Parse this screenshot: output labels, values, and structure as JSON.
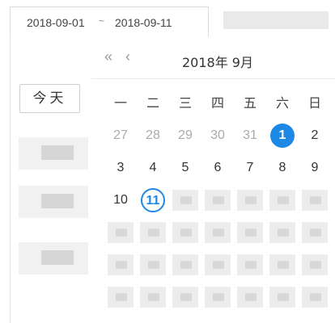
{
  "range": {
    "start": "2018-09-01",
    "separator": "~",
    "end": "2018-09-11"
  },
  "sidebar": {
    "today_label": "今天"
  },
  "calendar": {
    "title": "2018年 9月",
    "nav_prev_year": "«",
    "nav_prev_month": "‹",
    "weekdays": [
      "一",
      "二",
      "三",
      "四",
      "五",
      "六",
      "日"
    ],
    "row1": [
      "27",
      "28",
      "29",
      "30",
      "31",
      "1",
      "2"
    ],
    "row2": [
      "3",
      "4",
      "5",
      "6",
      "7",
      "8",
      "9"
    ],
    "row3_visible": [
      "10",
      "11"
    ],
    "selected_day": "1",
    "today_day": "11"
  },
  "colors": {
    "accent": "#1e88e5"
  }
}
